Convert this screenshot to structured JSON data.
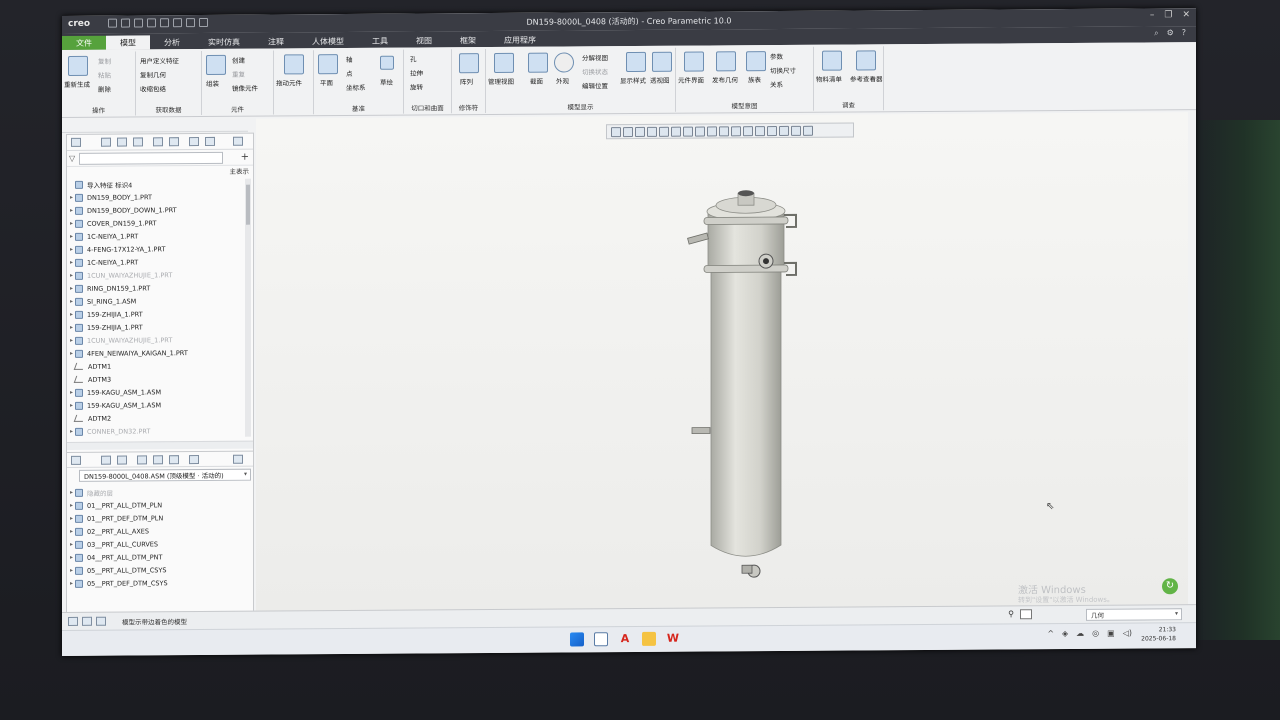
{
  "app": {
    "logo": "creo",
    "window_title": "DN159-8000L_0408 (活动的) - Creo Parametric 10.0"
  },
  "tabs": [
    "文件",
    "模型",
    "分析",
    "实时仿真",
    "注释",
    "人体模型",
    "工具",
    "视图",
    "框架",
    "应用程序"
  ],
  "active_tab": "模型",
  "ribbon": {
    "groups": [
      {
        "label": "操作",
        "items": [
          "重新生成",
          "复制",
          "粘贴",
          "删除"
        ]
      },
      {
        "label": "获取数据",
        "items": [
          "用户定义特征",
          "复制几何",
          "收缩包络"
        ]
      },
      {
        "label": "元件",
        "items": [
          "组装",
          "创建",
          "重复",
          "镜像元件"
        ]
      },
      {
        "label": "",
        "items": [
          "拖动元件"
        ]
      },
      {
        "label": "基准",
        "items": [
          "平面",
          "轴",
          "点",
          "坐标系",
          "草绘"
        ]
      },
      {
        "label": "切口和曲面",
        "items": [
          "孔",
          "拉伸",
          "旋转"
        ]
      },
      {
        "label": "修饰符",
        "items": [
          "阵列"
        ]
      },
      {
        "label": "模型显示",
        "items": [
          "管理视图",
          "截面",
          "外观",
          "分解视图",
          "切换状态",
          "编辑位置",
          "显示样式",
          "透视图"
        ]
      },
      {
        "label": "模型意图",
        "items": [
          "元件界面",
          "发布几何",
          "族表",
          "参数",
          "切换尺寸",
          "关系"
        ]
      },
      {
        "label": "调查",
        "items": [
          "物料清单",
          "参考查看器"
        ]
      }
    ]
  },
  "model_tree": {
    "filter_placeholder": "",
    "show_label": "主表示",
    "items": [
      {
        "name": "导入特征 标识4",
        "dim": false,
        "kind": "feature"
      },
      {
        "name": "DN159_BODY_1.PRT",
        "dim": false,
        "kind": "part"
      },
      {
        "name": "DN159_BODY_DOWN_1.PRT",
        "dim": false,
        "kind": "part"
      },
      {
        "name": "COVER_DN159_1.PRT",
        "dim": false,
        "kind": "part"
      },
      {
        "name": "1C-NEIYA_1.PRT",
        "dim": false,
        "kind": "part"
      },
      {
        "name": "4-FENG-17X12-YA_1.PRT",
        "dim": false,
        "kind": "part"
      },
      {
        "name": "1C-NEIYA_1.PRT",
        "dim": false,
        "kind": "part"
      },
      {
        "name": "1CUN_WAIYAZHUJIE_1.PRT",
        "dim": true,
        "kind": "part"
      },
      {
        "name": "RING_DN159_1.PRT",
        "dim": false,
        "kind": "part"
      },
      {
        "name": "SI_RING_1.ASM",
        "dim": false,
        "kind": "part"
      },
      {
        "name": "159-ZHIJIA_1.PRT",
        "dim": false,
        "kind": "part"
      },
      {
        "name": "159-ZHIJIA_1.PRT",
        "dim": false,
        "kind": "part"
      },
      {
        "name": "1CUN_WAIYAZHUJIE_1.PRT",
        "dim": true,
        "kind": "part"
      },
      {
        "name": "4FEN_NEIWAIYA_KAIGAN_1.PRT",
        "dim": false,
        "kind": "part"
      },
      {
        "name": "ADTM1",
        "dim": false,
        "kind": "datum"
      },
      {
        "name": "ADTM3",
        "dim": false,
        "kind": "datum"
      },
      {
        "name": "159-KAGU_ASM_1.ASM",
        "dim": false,
        "kind": "part"
      },
      {
        "name": "159-KAGU_ASM_1.ASM",
        "dim": false,
        "kind": "part"
      },
      {
        "name": "ADTM2",
        "dim": false,
        "kind": "datum"
      },
      {
        "name": "CONNER_DN32.PRT",
        "dim": true,
        "kind": "part"
      }
    ]
  },
  "layer_tree": {
    "assembly_select": "DN159-8000L_0408.ASM (顶级模型 · 活动的)",
    "items": [
      "隐藏的层",
      "01__PRT_ALL_DTM_PLN",
      "01__PRT_DEF_DTM_PLN",
      "02__PRT_ALL_AXES",
      "03__PRT_ALL_CURVES",
      "04__PRT_ALL_DTM_PNT",
      "05__PRT_ALL_DTM_CSYS",
      "05__PRT_DEF_DTM_CSYS"
    ]
  },
  "status": {
    "message": "模型示带边着色的模型",
    "filter_value": "几何"
  },
  "watermark": {
    "line1": "激活 Windows",
    "line2": "转到\"设置\"以激活 Windows。"
  },
  "taskbar": {
    "time": "21:33",
    "date": "2025-06-18"
  }
}
